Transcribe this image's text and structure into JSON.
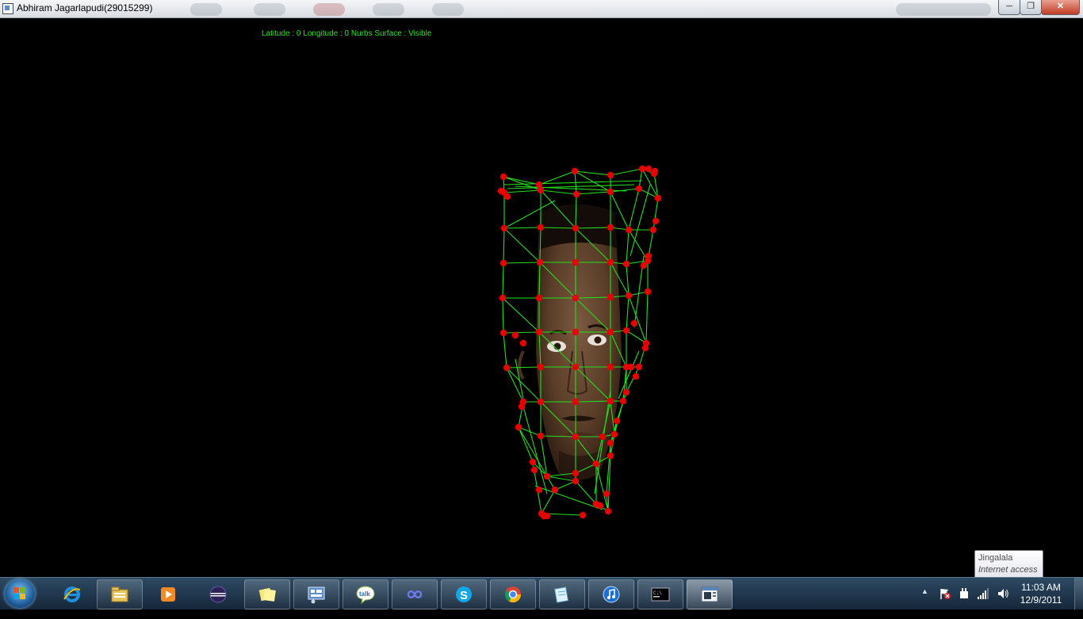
{
  "window": {
    "title": "Abhiram Jagarlapudi(29015299)",
    "minimize_symbol": "─",
    "maximize_symbol": "❐",
    "close_symbol": "✕"
  },
  "hud": {
    "status_text": "Latitude : 0 Longitude : 0 Nurbs Surface : Visible"
  },
  "colors": {
    "hud_text": "#26e620",
    "mesh_line": "#22e01a",
    "control_point": "#e60000",
    "background": "#000000"
  },
  "tooltip": {
    "network_name": "Jingalala",
    "network_status": "Internet access"
  },
  "taskbar": {
    "pinned": [
      {
        "name": "internet-explorer-icon"
      },
      {
        "name": "windows-explorer-icon"
      },
      {
        "name": "media-player-icon"
      },
      {
        "name": "eclipse-icon"
      },
      {
        "name": "sticky-notes-icon"
      },
      {
        "name": "control-panel-icon"
      },
      {
        "name": "google-talk-icon"
      },
      {
        "name": "infinity-app-icon"
      },
      {
        "name": "skype-icon"
      },
      {
        "name": "chrome-icon"
      },
      {
        "name": "notepad-icon"
      },
      {
        "name": "itunes-icon"
      },
      {
        "name": "command-prompt-icon"
      },
      {
        "name": "opengl-app-icon"
      }
    ],
    "tray_up_arrow": "▲",
    "volume_symbol": "🔊",
    "clock_time": "11:03 AM",
    "clock_date": "12/9/2011"
  }
}
